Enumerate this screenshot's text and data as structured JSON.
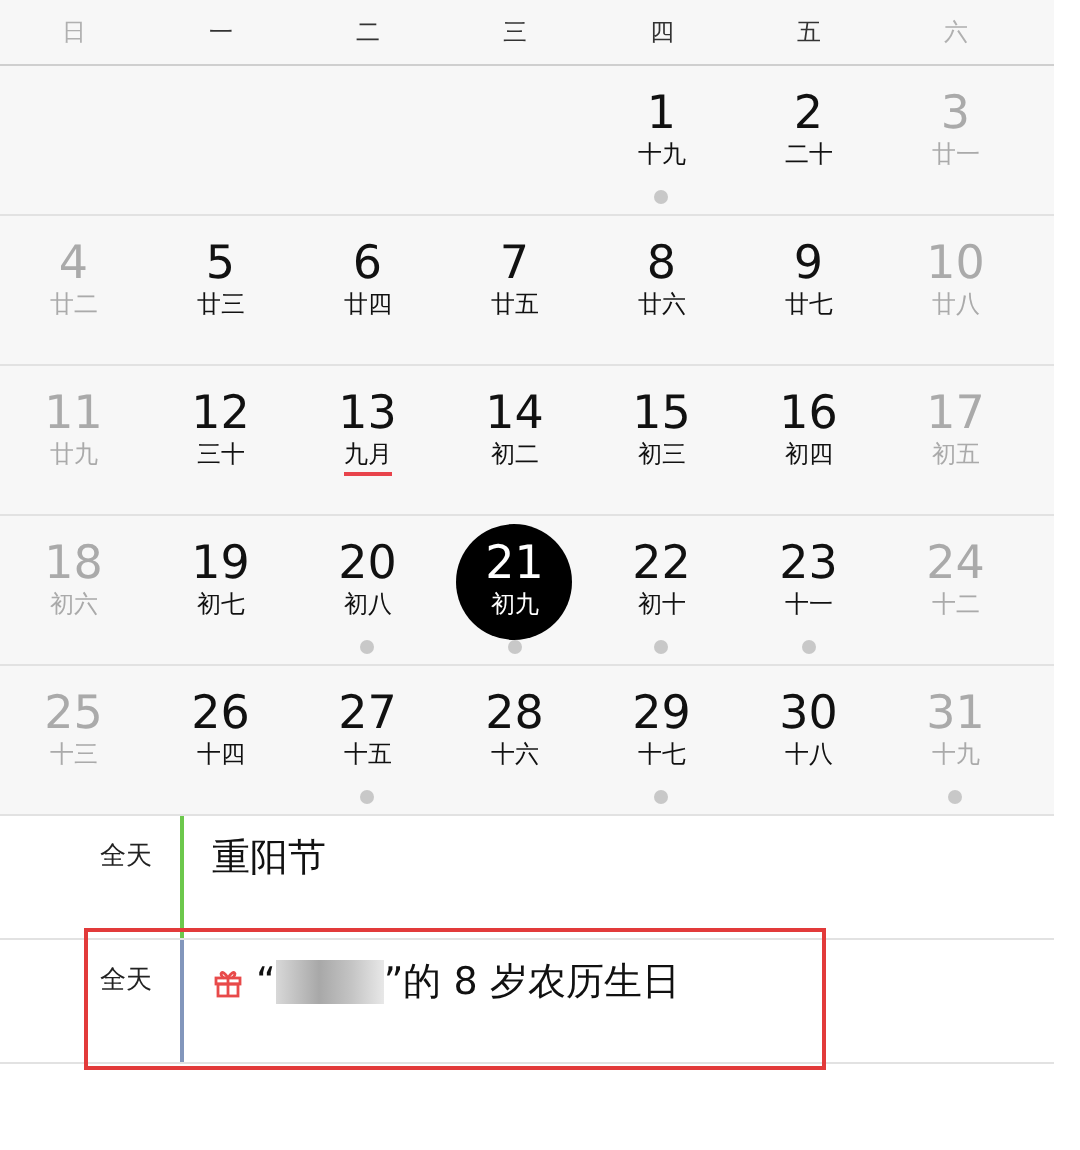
{
  "weekdays": [
    {
      "label": "日",
      "weekend": true
    },
    {
      "label": "一",
      "weekend": false
    },
    {
      "label": "二",
      "weekend": false
    },
    {
      "label": "三",
      "weekend": false
    },
    {
      "label": "四",
      "weekend": false
    },
    {
      "label": "五",
      "weekend": false
    },
    {
      "label": "六",
      "weekend": true
    }
  ],
  "days": [
    {
      "day": "1",
      "lunar": "十九",
      "weekend": false,
      "event": true,
      "selected": false,
      "month_start": false
    },
    {
      "day": "2",
      "lunar": "二十",
      "weekend": false,
      "event": false,
      "selected": false,
      "month_start": false
    },
    {
      "day": "3",
      "lunar": "廿一",
      "weekend": true,
      "event": false,
      "selected": false,
      "month_start": false
    },
    {
      "day": "4",
      "lunar": "廿二",
      "weekend": true,
      "event": false,
      "selected": false,
      "month_start": false
    },
    {
      "day": "5",
      "lunar": "廿三",
      "weekend": false,
      "event": false,
      "selected": false,
      "month_start": false
    },
    {
      "day": "6",
      "lunar": "廿四",
      "weekend": false,
      "event": false,
      "selected": false,
      "month_start": false
    },
    {
      "day": "7",
      "lunar": "廿五",
      "weekend": false,
      "event": false,
      "selected": false,
      "month_start": false
    },
    {
      "day": "8",
      "lunar": "廿六",
      "weekend": false,
      "event": false,
      "selected": false,
      "month_start": false
    },
    {
      "day": "9",
      "lunar": "廿七",
      "weekend": false,
      "event": false,
      "selected": false,
      "month_start": false
    },
    {
      "day": "10",
      "lunar": "廿八",
      "weekend": true,
      "event": false,
      "selected": false,
      "month_start": false
    },
    {
      "day": "11",
      "lunar": "廿九",
      "weekend": true,
      "event": false,
      "selected": false,
      "month_start": false
    },
    {
      "day": "12",
      "lunar": "三十",
      "weekend": false,
      "event": false,
      "selected": false,
      "month_start": false
    },
    {
      "day": "13",
      "lunar": "九月",
      "weekend": false,
      "event": false,
      "selected": false,
      "month_start": true
    },
    {
      "day": "14",
      "lunar": "初二",
      "weekend": false,
      "event": false,
      "selected": false,
      "month_start": false
    },
    {
      "day": "15",
      "lunar": "初三",
      "weekend": false,
      "event": false,
      "selected": false,
      "month_start": false
    },
    {
      "day": "16",
      "lunar": "初四",
      "weekend": false,
      "event": false,
      "selected": false,
      "month_start": false
    },
    {
      "day": "17",
      "lunar": "初五",
      "weekend": true,
      "event": false,
      "selected": false,
      "month_start": false
    },
    {
      "day": "18",
      "lunar": "初六",
      "weekend": true,
      "event": false,
      "selected": false,
      "month_start": false
    },
    {
      "day": "19",
      "lunar": "初七",
      "weekend": false,
      "event": false,
      "selected": false,
      "month_start": false
    },
    {
      "day": "20",
      "lunar": "初八",
      "weekend": false,
      "event": true,
      "selected": false,
      "month_start": false
    },
    {
      "day": "21",
      "lunar": "初九",
      "weekend": false,
      "event": true,
      "selected": true,
      "month_start": false
    },
    {
      "day": "22",
      "lunar": "初十",
      "weekend": false,
      "event": true,
      "selected": false,
      "month_start": false
    },
    {
      "day": "23",
      "lunar": "十一",
      "weekend": false,
      "event": true,
      "selected": false,
      "month_start": false
    },
    {
      "day": "24",
      "lunar": "十二",
      "weekend": true,
      "event": false,
      "selected": false,
      "month_start": false
    },
    {
      "day": "25",
      "lunar": "十三",
      "weekend": true,
      "event": false,
      "selected": false,
      "month_start": false
    },
    {
      "day": "26",
      "lunar": "十四",
      "weekend": false,
      "event": false,
      "selected": false,
      "month_start": false
    },
    {
      "day": "27",
      "lunar": "十五",
      "weekend": false,
      "event": true,
      "selected": false,
      "month_start": false
    },
    {
      "day": "28",
      "lunar": "十六",
      "weekend": false,
      "event": false,
      "selected": false,
      "month_start": false
    },
    {
      "day": "29",
      "lunar": "十七",
      "weekend": false,
      "event": true,
      "selected": false,
      "month_start": false
    },
    {
      "day": "30",
      "lunar": "十八",
      "weekend": false,
      "event": false,
      "selected": false,
      "month_start": false
    },
    {
      "day": "31",
      "lunar": "十九",
      "weekend": true,
      "event": true,
      "selected": false,
      "month_start": false
    }
  ],
  "events": [
    {
      "time": "全天",
      "color": "#6cc84c",
      "kind": "holiday",
      "title_before": "重阳节",
      "redacted": false,
      "highlighted": false
    },
    {
      "time": "全天",
      "color": "#8296bc",
      "kind": "birthday",
      "title_before": "“",
      "title_after": "”的 8 岁农历生日",
      "redacted": true,
      "highlighted": true
    }
  ]
}
